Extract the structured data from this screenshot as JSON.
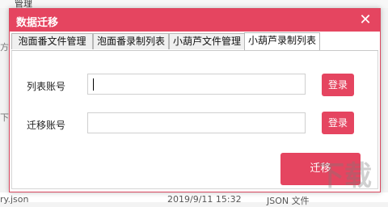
{
  "background": {
    "top_text": "管理",
    "left_fragments": [
      "方",
      "下"
    ],
    "file_row": {
      "name": "ry.json",
      "date": "2019/9/11 15:32",
      "type": "JSON 文件"
    }
  },
  "dialog": {
    "title": "数据迁移",
    "close_icon": "close-icon",
    "tabs": [
      "泡面番文件管理",
      "泡面番录制列表",
      "小葫芦文件管理",
      "小葫芦录制列表"
    ],
    "active_tab_index": 3,
    "form": {
      "list_account_label": "列表账号",
      "list_account_value": "",
      "migrate_account_label": "迁移账号",
      "migrate_account_value": "",
      "login_label": "登录",
      "migrate_button": "迁移"
    }
  },
  "colors": {
    "accent": "#e54560"
  }
}
